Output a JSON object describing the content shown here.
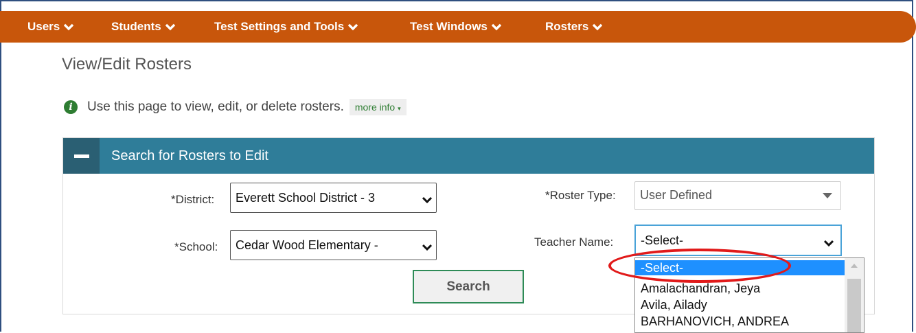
{
  "nav": {
    "items": [
      {
        "label": "Users"
      },
      {
        "label": "Students"
      },
      {
        "label": "Test Settings and Tools"
      },
      {
        "label": "Test Windows"
      },
      {
        "label": "Rosters"
      }
    ]
  },
  "page": {
    "title": "View/Edit Rosters",
    "info_text": "Use this page to view, edit, or delete rosters.",
    "more_info": "more info"
  },
  "panel": {
    "title": "Search for Rosters to Edit",
    "district_label": "*District:",
    "district_value": "Everett School District - 3",
    "school_label": "*School:",
    "school_value": "Cedar Wood Elementary -",
    "roster_type_label": "*Roster Type:",
    "roster_type_value": "User Defined",
    "teacher_label": "Teacher Name:",
    "teacher_value": "-Select-",
    "search_button": "Search"
  },
  "teacher_dropdown": {
    "options": [
      {
        "label": "-Select-",
        "selected": true
      },
      {
        "label": "Amalachandran, Jeya"
      },
      {
        "label": "Avila, Ailady"
      },
      {
        "label": "BARHANOVICH, ANDREA"
      }
    ]
  },
  "colors": {
    "nav_bg": "#c8560b",
    "panel_header": "#2f7d99",
    "highlight": "#e11a1a",
    "selected_option": "#1e90ff"
  }
}
